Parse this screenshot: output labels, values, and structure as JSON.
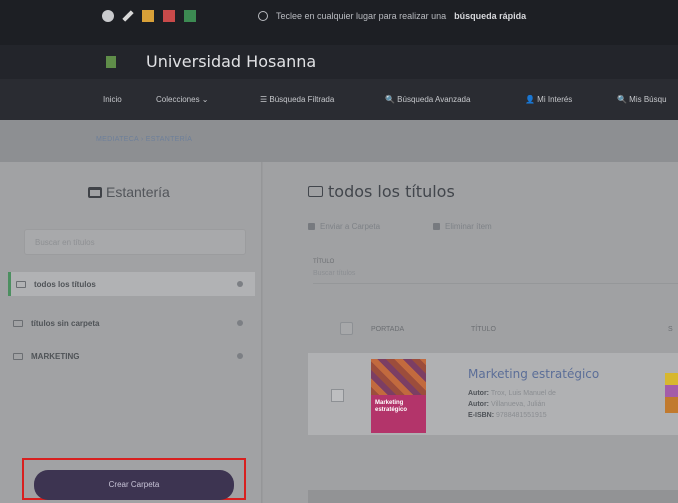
{
  "search_hint": {
    "text": "Teclee en cualquier lugar para realizar una",
    "bold": "búsqueda rápida"
  },
  "brand": {
    "name": "Universidad Hosanna"
  },
  "nav": [
    "Inicio",
    "Colecciones ⌄",
    "☰ Búsqueda Filtrada",
    "🔍 Búsqueda Avanzada",
    "👤 Mi Interés",
    "🔍 Mis Búsqu"
  ],
  "breadcrumb": {
    "text": "MEDIATECA  ›  ESTANTERÍA"
  },
  "sidebar": {
    "title": "Estantería",
    "search_placeholder": "Buscar en títulos",
    "folders": [
      {
        "label": "todos los títulos"
      },
      {
        "label": "títulos sin carpeta"
      },
      {
        "label": "MARKETING"
      }
    ],
    "create_button": "Crear Carpeta"
  },
  "main": {
    "title": "todos los títulos",
    "action_send": "Enviar a Carpeta",
    "action_remove": "Eliminar ítem",
    "filter_label": "TÍTULO",
    "filter_placeholder": "Buscar títulos",
    "columns": [
      "PORTADA",
      "TÍTULO",
      "S"
    ],
    "item": {
      "title": "Marketing estratégico",
      "cover_text": "Marketing estratégico",
      "author1_label": "Autor:",
      "author1": "Trox, Luis Manuel de",
      "author2_label": "Autor:",
      "author2": "Villanueva, Julián",
      "isbn_label": "E-ISBN:",
      "isbn": "9788481551915"
    }
  }
}
